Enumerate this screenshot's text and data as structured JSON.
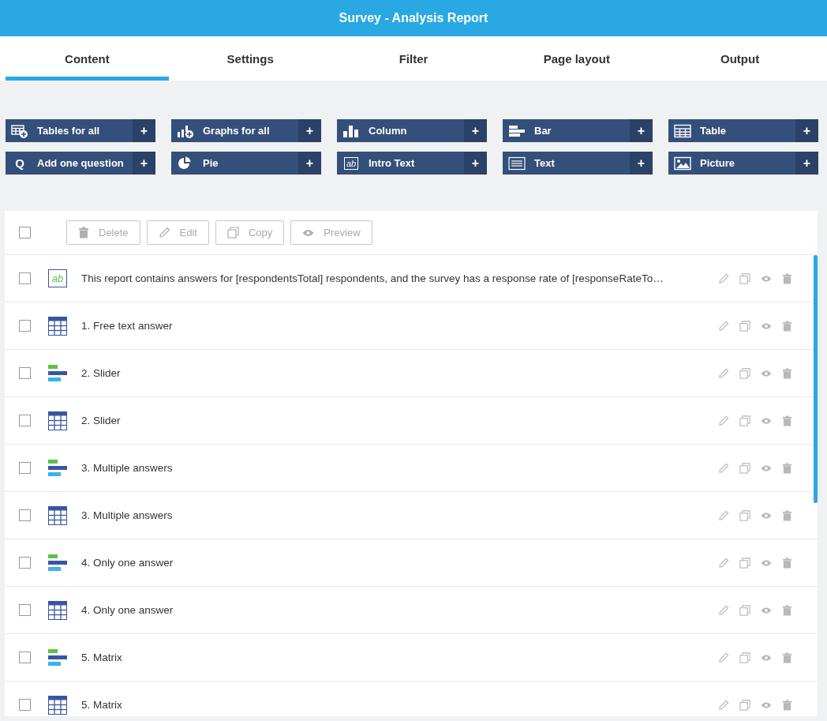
{
  "window": {
    "title": "Survey - Analysis Report"
  },
  "tabs": [
    {
      "label": "Content",
      "selected": true
    },
    {
      "label": "Settings",
      "selected": false
    },
    {
      "label": "Filter",
      "selected": false
    },
    {
      "label": "Page layout",
      "selected": false
    },
    {
      "label": "Output",
      "selected": false
    }
  ],
  "add_buttons": [
    {
      "kind": "tables",
      "label": "Tables for all",
      "plus": "+"
    },
    {
      "kind": "graphs",
      "label": "Graphs for all",
      "plus": "+"
    },
    {
      "kind": "column",
      "label": "Column",
      "plus": "+"
    },
    {
      "kind": "bar",
      "label": "Bar",
      "plus": "+"
    },
    {
      "kind": "table",
      "label": "Table",
      "plus": "+"
    },
    {
      "kind": "question",
      "label": "Add one question",
      "plus": "+",
      "glyph": "Q"
    },
    {
      "kind": "pie",
      "label": "Pie",
      "plus": "+"
    },
    {
      "kind": "intro",
      "label": "Intro Text",
      "plus": "+",
      "glyph": "ab"
    },
    {
      "kind": "text",
      "label": "Text",
      "plus": "+"
    },
    {
      "kind": "picture",
      "label": "Picture",
      "plus": "+"
    }
  ],
  "toolbar": {
    "select_all_checked": false,
    "actions": [
      {
        "kind": "delete",
        "label": "Delete"
      },
      {
        "kind": "edit",
        "label": "Edit"
      },
      {
        "kind": "copy",
        "label": "Copy"
      },
      {
        "kind": "preview",
        "label": "Preview"
      }
    ]
  },
  "items": [
    {
      "kind": "text",
      "glyph": "ab",
      "label": "This report contains answers for [respondentsTotal] respondents, and the survey has a response rate of [responseRateTo…",
      "checked": false
    },
    {
      "kind": "table",
      "label": "1. Free text answer",
      "checked": false
    },
    {
      "kind": "bar",
      "label": "2. Slider",
      "checked": false
    },
    {
      "kind": "table",
      "label": "2. Slider",
      "checked": false
    },
    {
      "kind": "bar",
      "label": "3. Multiple answers",
      "checked": false
    },
    {
      "kind": "table",
      "label": "3. Multiple answers",
      "checked": false
    },
    {
      "kind": "bar",
      "label": "4. Only one answer",
      "checked": false
    },
    {
      "kind": "table",
      "label": "4. Only one answer",
      "checked": false
    },
    {
      "kind": "bar",
      "label": "5. Matrix",
      "checked": false
    },
    {
      "kind": "table",
      "label": "5. Matrix",
      "checked": false
    }
  ]
}
